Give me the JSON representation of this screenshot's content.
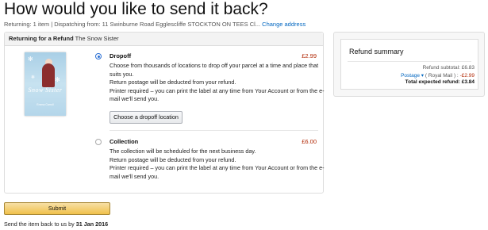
{
  "page": {
    "title": "How would you like to send it back?",
    "returning": "Returning: 1 item | Dispatching from: 11 Swinburne Road Egglescliffe STOCKTON ON TEES Cl...",
    "change_address": "Change address"
  },
  "card": {
    "header_bold": "Returning for a Refund",
    "header_item": "The Snow Sister",
    "book": {
      "title": "Snow Sister",
      "author": "Emma Carroll",
      "cover_colors": [
        "#a9cfe6",
        "#8b2e2e"
      ]
    },
    "options": [
      {
        "name": "Dropoff",
        "selected": true,
        "price": "£2.99",
        "lines": [
          "Choose from thousands of locations to drop off your parcel at a time and place that",
          "suits you.",
          "Return postage will be deducted from your refund.",
          "Printer required – you can print the label at any time from Your Account or from the e-",
          "mail we'll send you."
        ],
        "button": "Choose a dropoff location"
      },
      {
        "name": "Collection",
        "selected": false,
        "price": "£6.00",
        "lines": [
          "The collection will be scheduled for the next business day.",
          "Return postage will be deducted from your refund.",
          "Printer required – you can print the label at any time from Your Account or from the e-",
          "mail we'll send you."
        ]
      }
    ]
  },
  "summary": {
    "title": "Refund summary",
    "subtotal_label": "Refund subtotal:",
    "subtotal_value": "£6.83",
    "postage_link": "Postage",
    "postage_detail": "( Royal Mail ) :",
    "postage_value": "-£2.99",
    "total_label": "Total expected refund:",
    "total_value": "£3.84"
  },
  "submit_label": "Submit",
  "footer": {
    "prefix": "Send the item back to us by",
    "date": "31 Jan 2016"
  },
  "colors": {
    "link": "#0066c0",
    "price": "#b12704",
    "submit": "#f0c14b",
    "radio_selected": "#2a6fd4"
  }
}
